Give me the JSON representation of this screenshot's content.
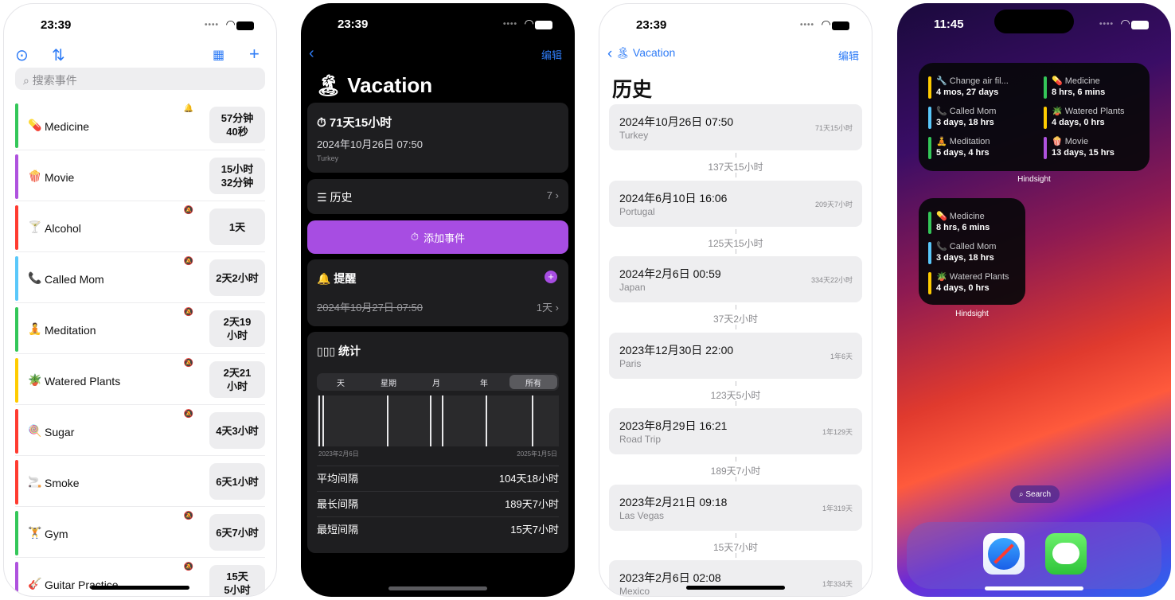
{
  "p1": {
    "time": "23:39",
    "search_placeholder": "搜索事件",
    "events": [
      {
        "emoji": "💊",
        "name": "Medicine",
        "badge": "57分钟\n40秒",
        "color": "#34c759",
        "bell": "🔔"
      },
      {
        "emoji": "🍿",
        "name": "Movie",
        "badge": "15小时\n32分钟",
        "color": "#af52de",
        "bell": ""
      },
      {
        "emoji": "🍸",
        "name": "Alcohol",
        "badge": "1天",
        "color": "#ff3b30",
        "bell": "🔕"
      },
      {
        "emoji": "📞",
        "name": "Called Mom",
        "badge": "2天2小时",
        "color": "#5ac8fa",
        "bell": "🔕"
      },
      {
        "emoji": "🧘",
        "name": "Meditation",
        "badge": "2天19\n小时",
        "color": "#34c759",
        "bell": "🔕"
      },
      {
        "emoji": "🪴",
        "name": "Watered Plants",
        "badge": "2天21\n小时",
        "color": "#ffcc00",
        "bell": "🔕"
      },
      {
        "emoji": "🍭",
        "name": "Sugar",
        "badge": "4天3小时",
        "color": "#ff3b30",
        "bell": "🔕"
      },
      {
        "emoji": "🚬",
        "name": "Smoke",
        "badge": "6天1小时",
        "color": "#ff3b30",
        "bell": ""
      },
      {
        "emoji": "🏋",
        "name": "Gym",
        "badge": "6天7小时",
        "color": "#34c759",
        "bell": "🔕"
      },
      {
        "emoji": "🎸",
        "name": "Guitar Practice",
        "badge": "15天\n5小时",
        "color": "#af52de",
        "bell": "🔕"
      }
    ]
  },
  "p2": {
    "time": "23:39",
    "edit": "编辑",
    "title_emoji": "🏝",
    "title": "Vacation",
    "since": "71天15小时",
    "date": "2024年10月26日 07:50",
    "place": "Turkey",
    "history_label": "历史",
    "history_count": "7",
    "add_event": "添加事件",
    "reminder_label": "提醒",
    "reminder_date": "2024年10月27日 07:50",
    "reminder_offset": "1天",
    "stats_label": "统计",
    "segments": [
      "天",
      "星期",
      "月",
      "年",
      "所有"
    ],
    "selected_segment": "所有",
    "axis_start": "2023年2月6日",
    "axis_end": "2025年1月5日",
    "stats": [
      {
        "label": "平均间隔",
        "value": "104天18小时"
      },
      {
        "label": "最长间隔",
        "value": "189天7小时"
      },
      {
        "label": "最短间隔",
        "value": "15天7小时"
      }
    ]
  },
  "p3": {
    "time": "23:39",
    "back_label": "Vacation",
    "back_emoji": "🏝",
    "edit": "编辑",
    "title": "历史",
    "entries": [
      {
        "date": "2024年10月26日 07:50",
        "place": "Turkey",
        "dur": "71天15小时"
      },
      {
        "date": "2024年6月10日 16:06",
        "place": "Portugal",
        "dur": "209天7小时"
      },
      {
        "date": "2024年2月6日 00:59",
        "place": "Japan",
        "dur": "334天22小时"
      },
      {
        "date": "2023年12月30日 22:00",
        "place": "Paris",
        "dur": "1年6天"
      },
      {
        "date": "2023年8月29日 16:21",
        "place": "Road Trip",
        "dur": "1年129天"
      },
      {
        "date": "2023年2月21日 09:18",
        "place": "Las Vegas",
        "dur": "1年319天"
      },
      {
        "date": "2023年2月6日 02:08",
        "place": "Mexico",
        "dur": "1年334天"
      }
    ],
    "gaps": [
      "137天15小时",
      "125天15小时",
      "37天2小时",
      "123天5小时",
      "189天7小时",
      "15天7小时"
    ]
  },
  "p4": {
    "time": "11:45",
    "widget_label": "Hindsight",
    "search": "Search",
    "large_widget": [
      {
        "emoji": "🔧",
        "name": "Change air fil...",
        "value": "4 mos, 27 days",
        "color": "#ffcc00"
      },
      {
        "emoji": "💊",
        "name": "Medicine",
        "value": "8 hrs, 6 mins",
        "color": "#34c759"
      },
      {
        "emoji": "📞",
        "name": "Called Mom",
        "value": "3 days, 18 hrs",
        "color": "#5ac8fa"
      },
      {
        "emoji": "🪴",
        "name": "Watered Plants",
        "value": "4 days, 0 hrs",
        "color": "#ffcc00"
      },
      {
        "emoji": "🧘",
        "name": "Meditation",
        "value": "5 days, 4 hrs",
        "color": "#34c759"
      },
      {
        "emoji": "🍿",
        "name": "Movie",
        "value": "13 days, 15 hrs",
        "color": "#af52de"
      }
    ],
    "small_widget": [
      {
        "emoji": "💊",
        "name": "Medicine",
        "value": "8 hrs, 6 mins",
        "color": "#34c759"
      },
      {
        "emoji": "📞",
        "name": "Called Mom",
        "value": "3 days, 18 hrs",
        "color": "#5ac8fa"
      },
      {
        "emoji": "🪴",
        "name": "Watered Plants",
        "value": "4 days, 0 hrs",
        "color": "#ffcc00"
      }
    ]
  },
  "colors": {
    "accent": "#2f7cf6",
    "purple": "#a74de2"
  }
}
